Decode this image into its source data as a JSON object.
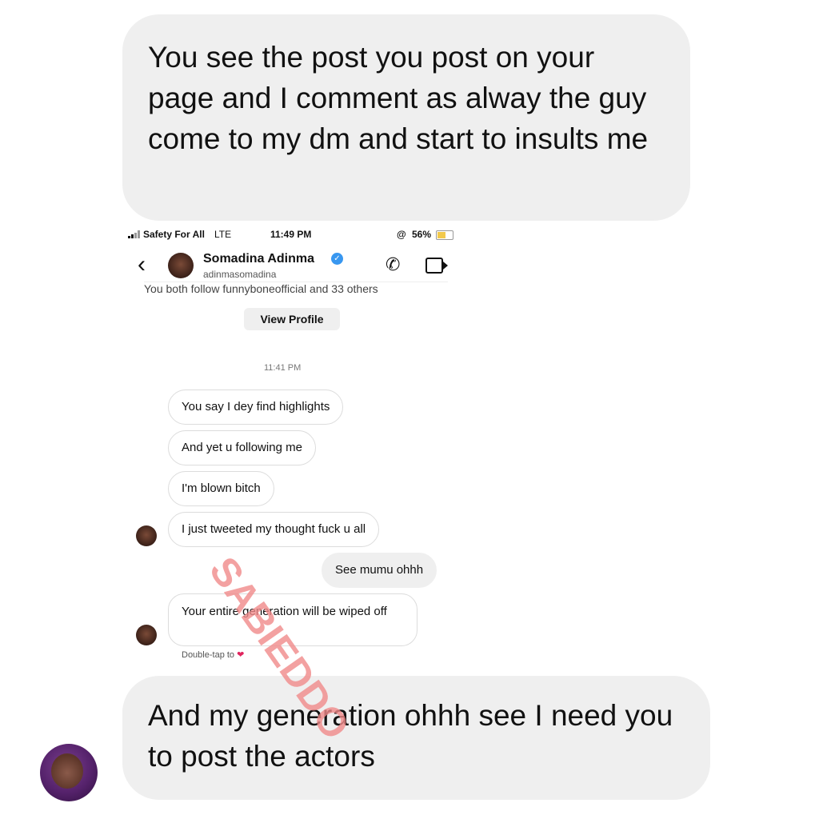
{
  "top_bubble": {
    "text": "You see the post you post on your page and I comment as alway the guy come to my dm and start to insults me"
  },
  "status_bar": {
    "carrier": "Safety For All",
    "network": "LTE",
    "time": "11:49 PM",
    "battery": "56%",
    "battery_level": 0.56
  },
  "dm_header": {
    "back_icon": "chevron-left-icon",
    "name": "Somadina Adinma",
    "verified_mark": "✓",
    "username": "adinmasomadina",
    "follow_text": "You both follow funnyboneofficial and 33 others",
    "view_profile": "View Profile"
  },
  "conversation": {
    "timestamp": "11:41 PM",
    "messages": [
      {
        "text": "You say I dey find highlights",
        "from": "them"
      },
      {
        "text": "And yet u following me",
        "from": "them"
      },
      {
        "text": "I'm blown bitch",
        "from": "them"
      },
      {
        "text": "I just tweeted my thought fuck u all",
        "from": "them"
      },
      {
        "text": "See mumu  ohhh",
        "from": "me"
      },
      {
        "text": "Your entire generation will be wiped off",
        "from": "them"
      }
    ],
    "double_tap": "Double-tap to",
    "heart": "❤"
  },
  "bottom_bubble": {
    "text": "And my generation ohhh see I need you to post the actors"
  },
  "watermark": {
    "text": "SABIEDDO",
    "color": "#f08a8a"
  }
}
